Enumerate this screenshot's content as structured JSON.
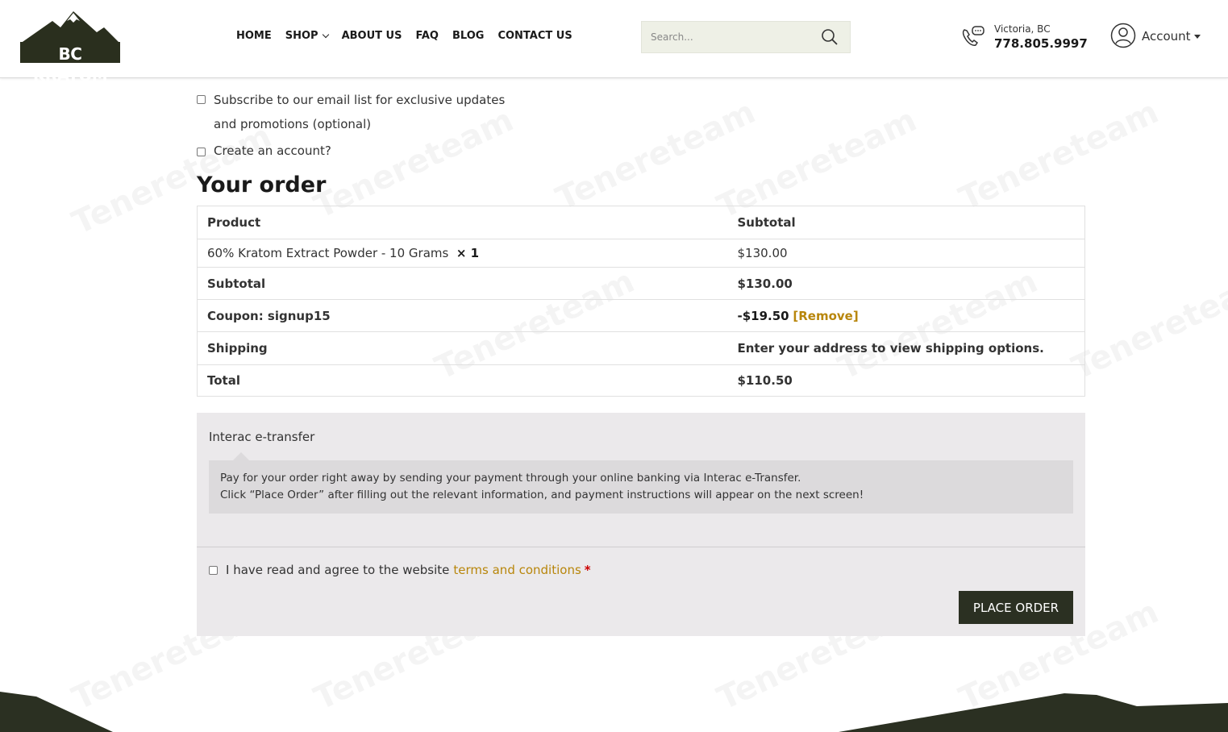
{
  "header": {
    "logo_text": "BC KRATOM",
    "nav": [
      {
        "label": "HOME",
        "has_dropdown": false
      },
      {
        "label": "SHOP",
        "has_dropdown": true
      },
      {
        "label": "ABOUT US",
        "has_dropdown": false
      },
      {
        "label": "FAQ",
        "has_dropdown": false
      },
      {
        "label": "BLOG",
        "has_dropdown": false
      },
      {
        "label": "CONTACT US",
        "has_dropdown": false
      }
    ],
    "search": {
      "placeholder": "Search..."
    },
    "location": "Victoria, BC",
    "phone": "778.805.9997",
    "account_label": "Account"
  },
  "checkout": {
    "subscribe_label": "Subscribe to our email list for exclusive updates and promotions (optional)",
    "create_account_label": "Create an account?",
    "order_title": "Your order",
    "table": {
      "headers": [
        "Product",
        "Subtotal"
      ],
      "product_name": "60% Kratom Extract Powder - 10 Grams",
      "product_qty": "× 1",
      "product_price": "$130.00",
      "subtotal_label": "Subtotal",
      "subtotal_value": "$130.00",
      "coupon_label": "Coupon: signup15",
      "coupon_value": "-$19.50",
      "coupon_remove": "[Remove]",
      "shipping_label": "Shipping",
      "shipping_value": "Enter your address to view shipping options.",
      "total_label": "Total",
      "total_value": "$110.50"
    },
    "payment": {
      "method_label": "Interac e-transfer",
      "description_line1": "Pay for your order right away by sending your payment through your online banking via Interac e-Transfer.",
      "description_line2": "Click “Place Order” after filling out the relevant information, and payment instructions will appear on the next screen!",
      "terms_prefix": "I have read and agree to the website",
      "terms_link": "terms and conditions",
      "required_mark": "*",
      "place_order_label": "PLACE ORDER"
    }
  },
  "watermark": "Tenereteam",
  "colors": {
    "brand_dark": "#2b3022",
    "link_gold": "#b8860b",
    "payment_bg": "#ebe9eb",
    "search_bg": "#eef0e6"
  }
}
